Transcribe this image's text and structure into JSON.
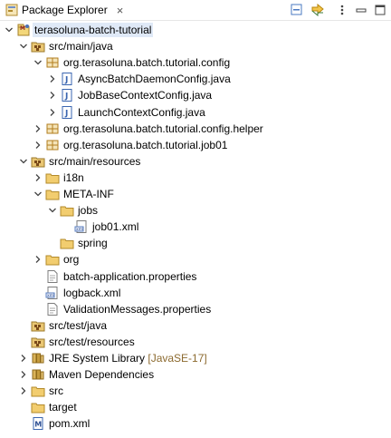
{
  "view": {
    "title": "Package Explorer",
    "close_glyph": "×",
    "toolbar": [
      "collapse-all-icon",
      "link-with-editor-icon",
      "view-menu-icon",
      "minimize-icon",
      "maximize-icon"
    ]
  },
  "tree": [
    {
      "label": "terasoluna-batch-tutorial",
      "icon": "maven-project-icon",
      "expanded": true,
      "depth": 0
    },
    {
      "label": "src/main/java",
      "icon": "source-folder-icon",
      "expanded": true,
      "depth": 1
    },
    {
      "label": "org.terasoluna.batch.tutorial.config",
      "icon": "package-icon",
      "expanded": true,
      "depth": 2
    },
    {
      "label": "AsyncBatchDaemonConfig.java",
      "icon": "java-file-icon",
      "expanded": false,
      "depth": 3
    },
    {
      "label": "JobBaseContextConfig.java",
      "icon": "java-file-icon",
      "expanded": false,
      "depth": 3
    },
    {
      "label": "LaunchContextConfig.java",
      "icon": "java-file-icon",
      "expanded": false,
      "depth": 3
    },
    {
      "label": "org.terasoluna.batch.tutorial.config.helper",
      "icon": "package-icon",
      "expanded": false,
      "depth": 2
    },
    {
      "label": "org.terasoluna.batch.tutorial.job01",
      "icon": "package-icon",
      "expanded": false,
      "depth": 2
    },
    {
      "label": "src/main/resources",
      "icon": "source-folder-icon",
      "expanded": true,
      "depth": 1
    },
    {
      "label": "i18n",
      "icon": "folder-icon",
      "expanded": false,
      "depth": 2
    },
    {
      "label": "META-INF",
      "icon": "folder-icon",
      "expanded": true,
      "depth": 2
    },
    {
      "label": "jobs",
      "icon": "folder-icon",
      "expanded": true,
      "depth": 3
    },
    {
      "label": "job01.xml",
      "icon": "xml-file-icon",
      "expanded": null,
      "depth": 4
    },
    {
      "label": "spring",
      "icon": "folder-icon",
      "expanded": null,
      "depth": 3
    },
    {
      "label": "org",
      "icon": "folder-icon",
      "expanded": false,
      "depth": 2
    },
    {
      "label": "batch-application.properties",
      "icon": "file-icon",
      "expanded": null,
      "depth": 2
    },
    {
      "label": "logback.xml",
      "icon": "xml-file-icon",
      "expanded": null,
      "depth": 2
    },
    {
      "label": "ValidationMessages.properties",
      "icon": "file-icon",
      "expanded": null,
      "depth": 2
    },
    {
      "label": "src/test/java",
      "icon": "source-folder-icon",
      "expanded": null,
      "depth": 1
    },
    {
      "label": "src/test/resources",
      "icon": "source-folder-icon",
      "expanded": null,
      "depth": 1
    },
    {
      "label": "JRE System Library",
      "decor": "[JavaSE-17]",
      "icon": "library-icon",
      "expanded": false,
      "depth": 1
    },
    {
      "label": "Maven Dependencies",
      "icon": "library-icon",
      "expanded": false,
      "depth": 1
    },
    {
      "label": "src",
      "icon": "folder-icon",
      "expanded": false,
      "depth": 1
    },
    {
      "label": "target",
      "icon": "folder-icon",
      "expanded": null,
      "depth": 1
    },
    {
      "label": "pom.xml",
      "icon": "maven-pom-icon",
      "expanded": null,
      "depth": 1
    }
  ]
}
